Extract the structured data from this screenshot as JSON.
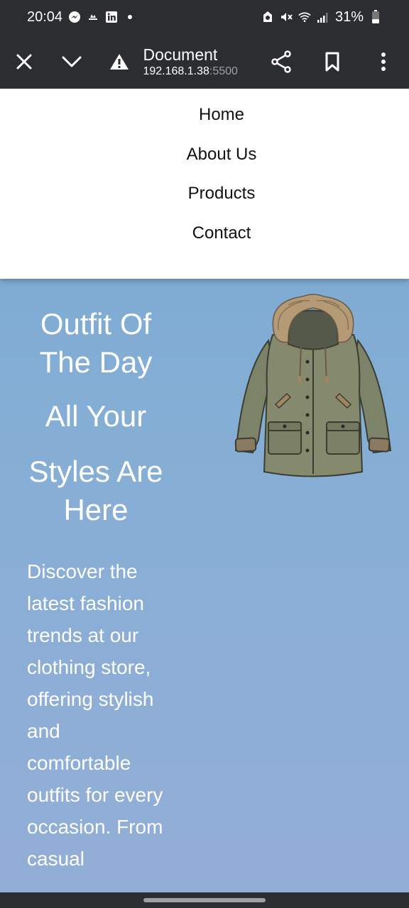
{
  "status_bar": {
    "time": "20:04",
    "battery": "31%",
    "left_icons": [
      "messenger-icon",
      "cloud-icon",
      "linkedin-icon",
      "dot-icon"
    ],
    "right_icons": [
      "alarm-icon",
      "mute-icon",
      "wifi-icon",
      "signal-icon",
      "battery-icon"
    ]
  },
  "toolbar": {
    "title": "Document",
    "host": "192.168.1.38",
    "port": ":5500",
    "icons": [
      "close-icon",
      "chevron-down-icon",
      "warning-icon",
      "share-icon",
      "bookmark-icon",
      "more-vert-icon"
    ]
  },
  "menu": {
    "items": [
      {
        "label": "Home"
      },
      {
        "label": "About Us"
      },
      {
        "label": "Products"
      },
      {
        "label": "Contact"
      }
    ]
  },
  "hero": {
    "title_line1": "Outfit Of The Day",
    "title_line2": "All Your",
    "title_line3": "Styles Are Here",
    "description": "Discover the latest fashion trends at our clothing store, offering stylish and comfortable outfits for every occasion. From casual",
    "image_alt": "jacket-image"
  },
  "colors": {
    "chrome": "#2b2d31",
    "hero_top": "#78a9d2",
    "hero_bottom": "#93aed6",
    "menu_bg": "#ffffff"
  }
}
